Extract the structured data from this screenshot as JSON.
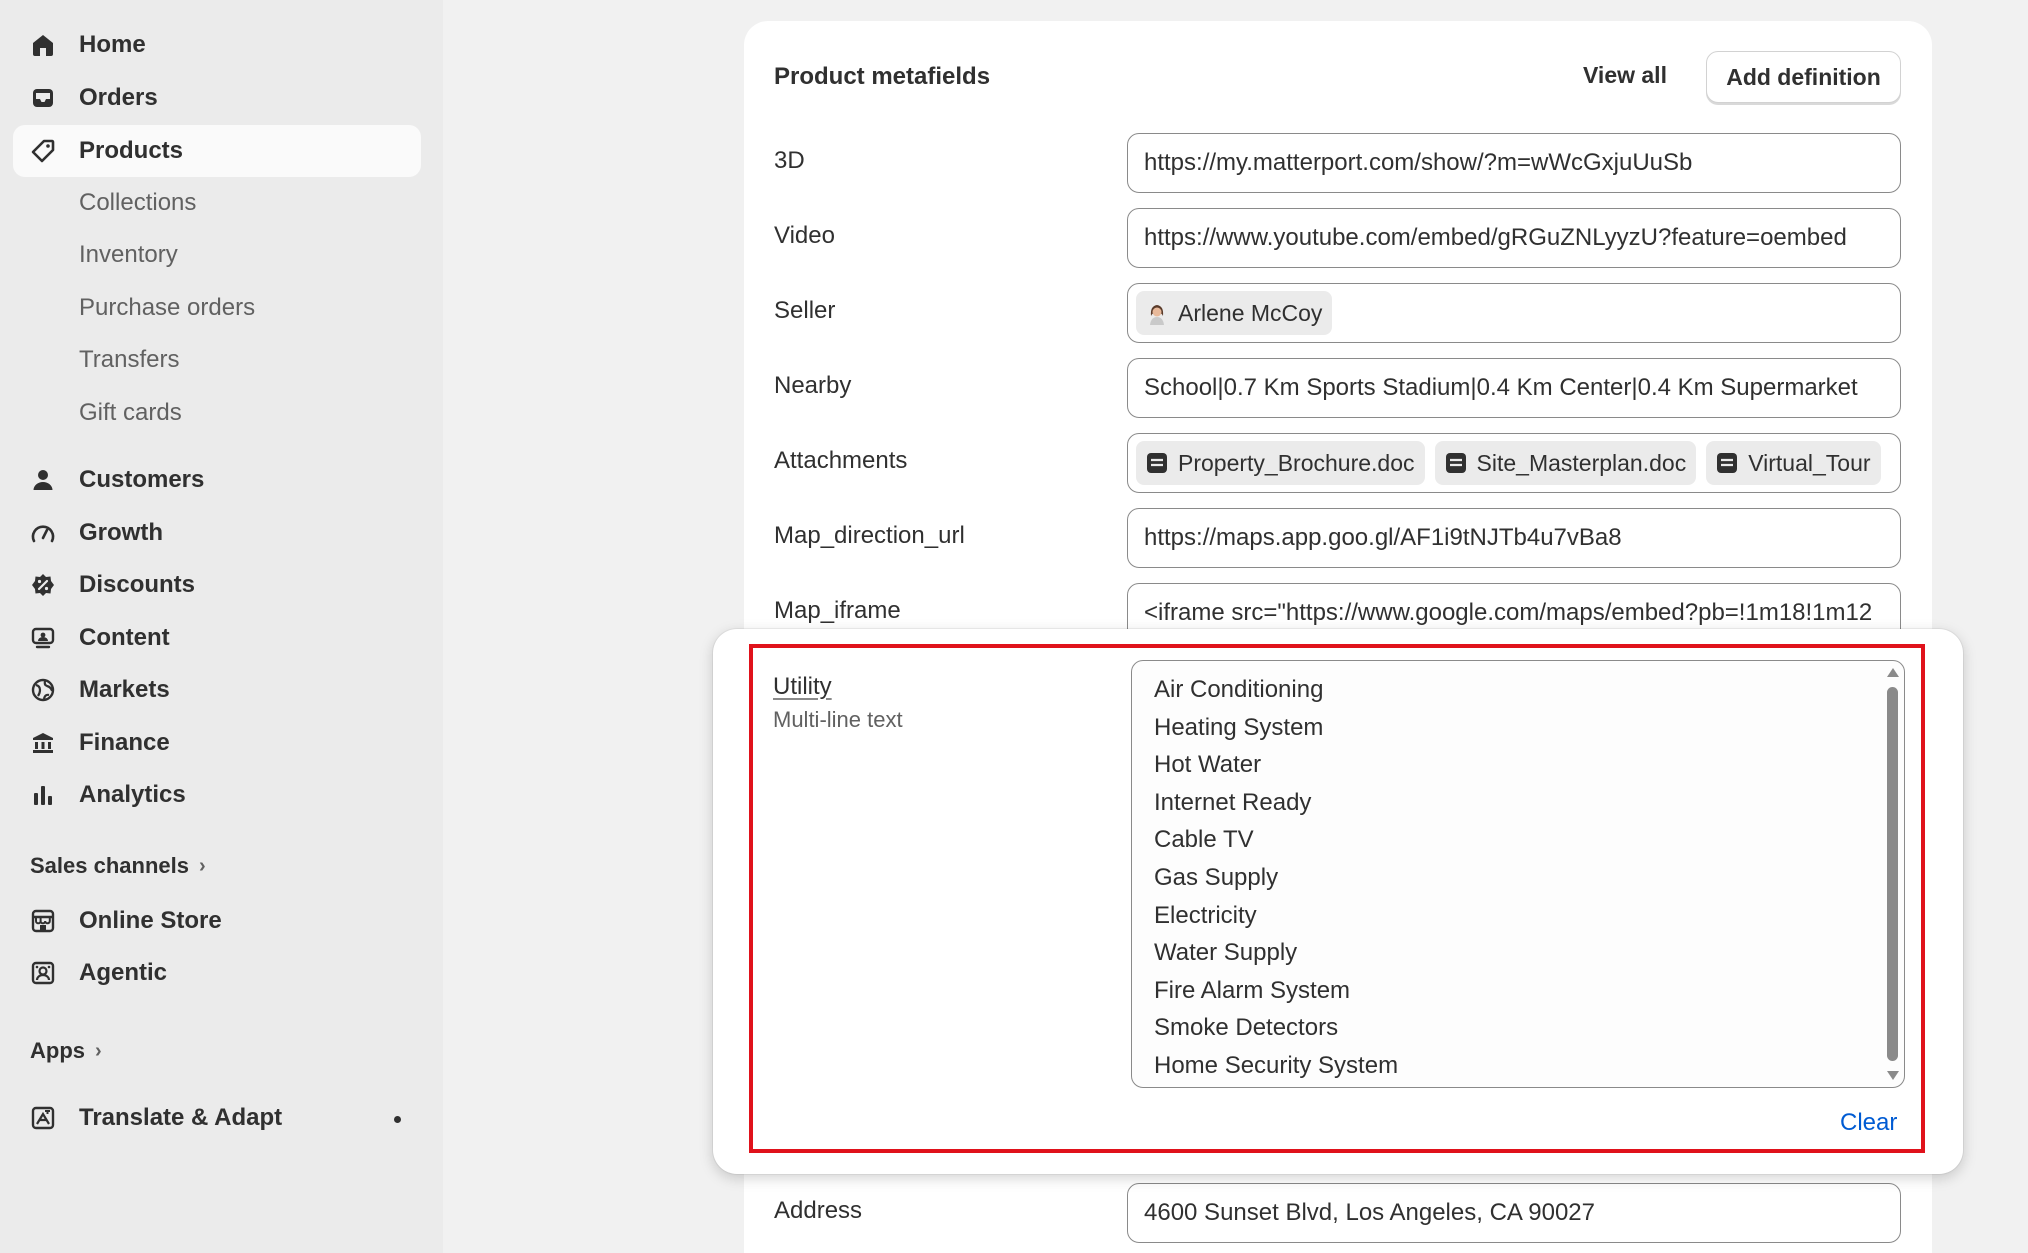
{
  "sidebar": {
    "main_items": [
      {
        "label": "Home",
        "icon": "home-icon"
      },
      {
        "label": "Orders",
        "icon": "inbox-icon"
      },
      {
        "label": "Products",
        "icon": "tag-icon",
        "active": true
      }
    ],
    "product_subitems": [
      "Collections",
      "Inventory",
      "Purchase orders",
      "Transfers",
      "Gift cards"
    ],
    "secondary_items": [
      {
        "label": "Customers",
        "icon": "person-icon"
      },
      {
        "label": "Growth",
        "icon": "gauge-icon"
      },
      {
        "label": "Discounts",
        "icon": "discount-icon"
      },
      {
        "label": "Content",
        "icon": "content-icon"
      },
      {
        "label": "Markets",
        "icon": "globe-icon"
      },
      {
        "label": "Finance",
        "icon": "bank-icon"
      },
      {
        "label": "Analytics",
        "icon": "bar-chart-icon"
      }
    ],
    "sales_channels_label": "Sales channels",
    "channel_items": [
      {
        "label": "Online Store",
        "icon": "store-icon"
      },
      {
        "label": "Agentic",
        "icon": "agentic-icon"
      }
    ],
    "apps_label": "Apps",
    "app_items": [
      {
        "label": "Translate & Adapt",
        "icon": "translate-icon"
      }
    ]
  },
  "metafields": {
    "title": "Product metafields",
    "view_all_label": "View all",
    "add_definition_label": "Add definition",
    "fields": {
      "three_d": {
        "label": "3D",
        "value": "https://my.matterport.com/show/?m=wWcGxjuUuSb"
      },
      "video": {
        "label": "Video",
        "value": "https://www.youtube.com/embed/gRGuZNLyyzU?feature=oembed"
      },
      "seller": {
        "label": "Seller",
        "value": "Arlene McCoy"
      },
      "nearby": {
        "label": "Nearby",
        "value": "School|0.7 Km Sports Stadium|0.4 Km Center|0.4 Km Supermarket"
      },
      "attachments": {
        "label": "Attachments",
        "files": [
          "Property_Brochure.doc",
          "Site_Masterplan.doc",
          "Virtual_Tour"
        ]
      },
      "map_direction_url": {
        "label": "Map_direction_url",
        "value": "https://maps.app.goo.gl/AF1i9tNJTb4u7vBa8"
      },
      "map_iframe": {
        "label": "Map_iframe",
        "value": "<iframe src=\"https://www.google.com/maps/embed?pb=!1m18!1m12"
      },
      "address": {
        "label": "Address",
        "value": "4600 Sunset Blvd, Los Angeles, CA 90027"
      }
    }
  },
  "utility_editor": {
    "label": "Utility",
    "type_label": "Multi-line text",
    "lines": [
      "Air Conditioning",
      "Heating System",
      "Hot Water",
      "Internet Ready",
      "Cable TV",
      "Gas Supply",
      "Electricity",
      "Water Supply",
      "Fire Alarm System",
      "Smoke Detectors",
      "Home Security System"
    ],
    "clear_label": "Clear",
    "highlight_color": "#e0121b"
  },
  "colors": {
    "accent_link": "#005bd3",
    "sidebar_bg": "#ebebeb",
    "page_bg": "#f1f1f1"
  }
}
